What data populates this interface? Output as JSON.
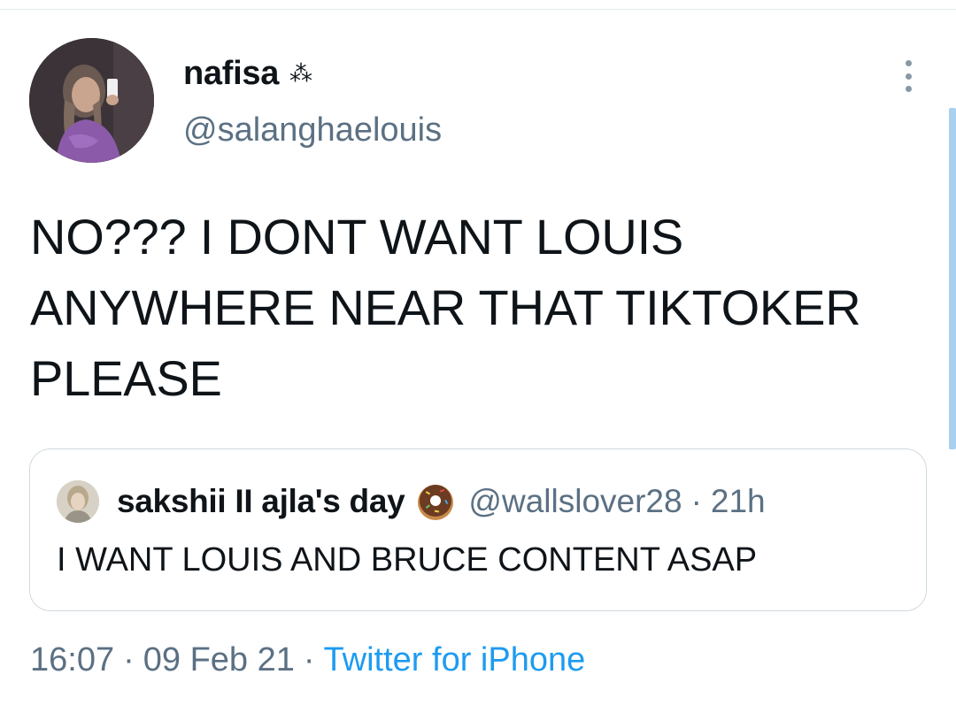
{
  "tweet": {
    "author": {
      "display_name": "nafisa",
      "name_emoji": "⁂",
      "handle": "@salanghaelouis"
    },
    "text": "NO??? I DONT WANT LOUIS ANYWHERE NEAR THAT TIKTOKER PLEASE",
    "more_icon": "more-vertical-icon",
    "quoted": {
      "display_name": "sakshii II ajla's day",
      "emoji": "donut-icon",
      "handle": "@wallslover28",
      "separator": "·",
      "time": "21h",
      "text": "I WANT LOUIS AND BRUCE CONTENT ASAP"
    },
    "meta": {
      "time": "16:07",
      "separator": "·",
      "date": "09 Feb 21",
      "source": "Twitter for iPhone"
    }
  },
  "colors": {
    "text": "#0f1419",
    "secondary": "#5b7083",
    "link": "#1d9bf0",
    "border": "#cfd9de",
    "scrollbar": "#a9d0ee"
  }
}
